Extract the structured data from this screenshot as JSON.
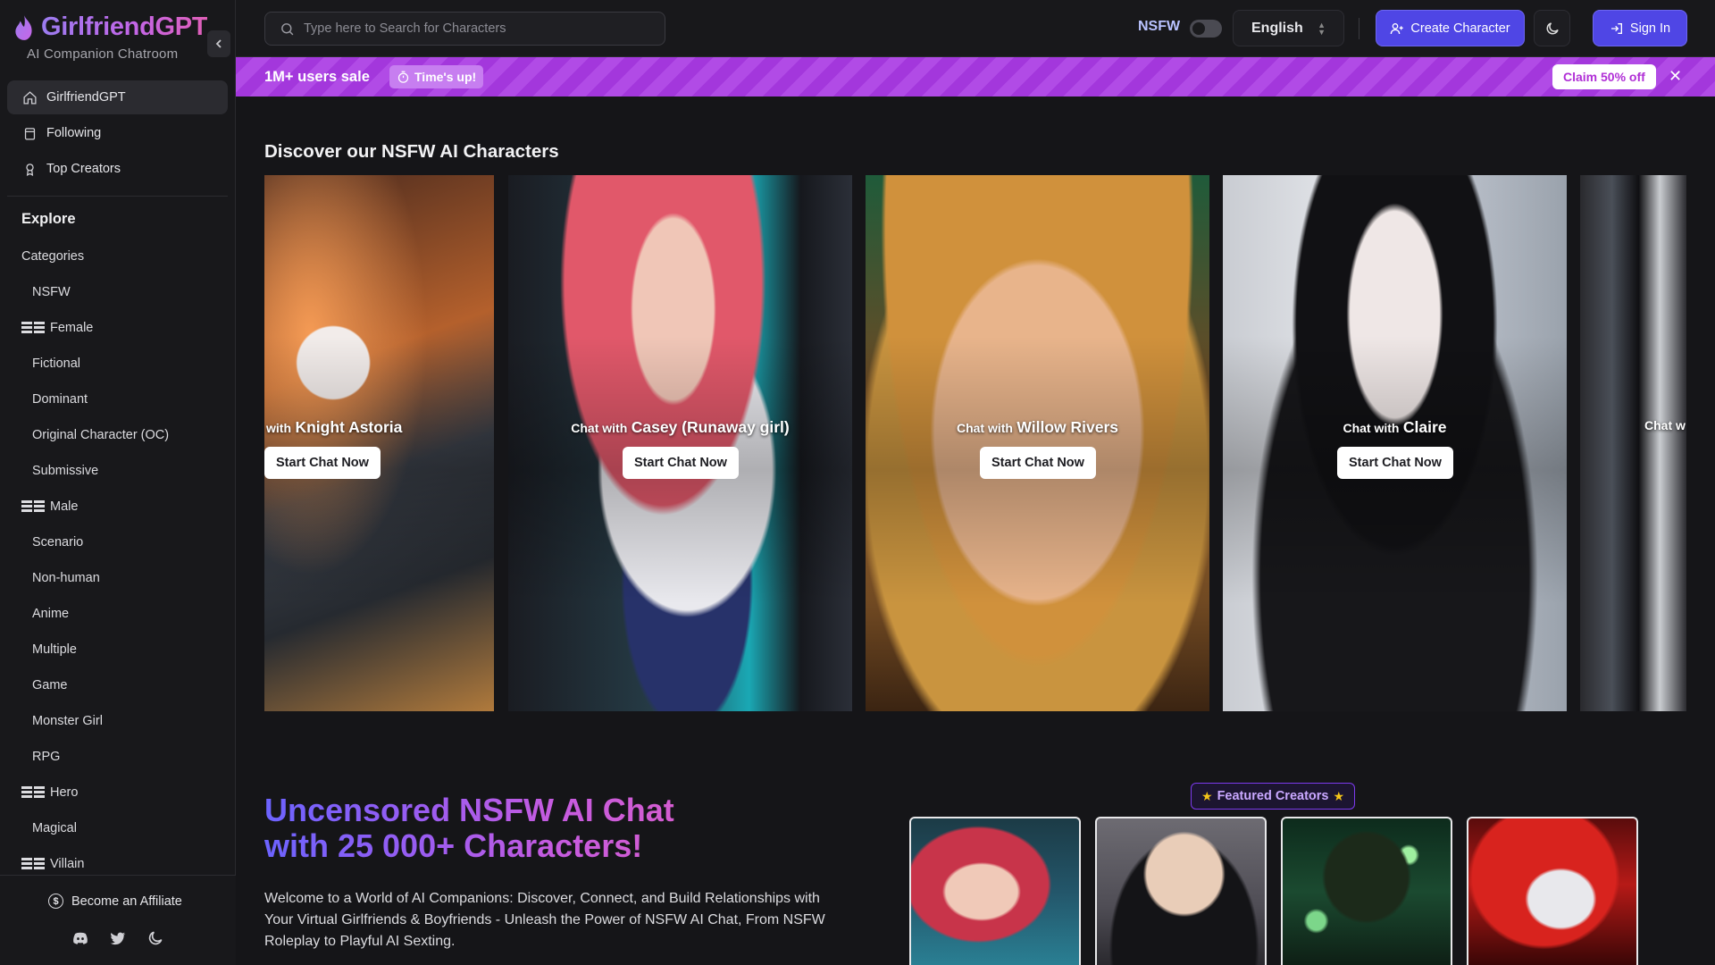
{
  "app": {
    "title": "GirlfriendGPT",
    "subtitle": "AI Companion Chatroom"
  },
  "colors": {
    "accent": "#4f46e5",
    "promo": "#a337dc",
    "brand_gradient_start": "#9b7cf0",
    "brand_gradient_end": "#e05fb8"
  },
  "sidebar": {
    "nav": [
      {
        "label": "GirlfriendGPT",
        "icon": "home-icon",
        "active": true
      },
      {
        "label": "Following",
        "icon": "bookmark-icon"
      },
      {
        "label": "Top Creators",
        "icon": "award-icon"
      }
    ],
    "explore_title": "Explore",
    "categories_label": "Categories",
    "categories": [
      {
        "label": "NSFW",
        "type": "sub"
      },
      {
        "label": "Female",
        "type": "head"
      },
      {
        "label": "Fictional",
        "type": "sub"
      },
      {
        "label": "Dominant",
        "type": "sub"
      },
      {
        "label": "Original Character (OC)",
        "type": "sub"
      },
      {
        "label": "Submissive",
        "type": "sub"
      },
      {
        "label": "Male",
        "type": "head"
      },
      {
        "label": "Scenario",
        "type": "sub"
      },
      {
        "label": "Non-human",
        "type": "sub"
      },
      {
        "label": "Anime",
        "type": "sub"
      },
      {
        "label": "Multiple",
        "type": "sub"
      },
      {
        "label": "Game",
        "type": "sub"
      },
      {
        "label": "Monster Girl",
        "type": "sub"
      },
      {
        "label": "RPG",
        "type": "sub"
      },
      {
        "label": "Hero",
        "type": "head"
      },
      {
        "label": "Magical",
        "type": "sub"
      },
      {
        "label": "Villain",
        "type": "head"
      }
    ],
    "affiliate_label": "Become an Affiliate",
    "socials": [
      "discord-icon",
      "twitter-icon",
      "moon-icon"
    ]
  },
  "header": {
    "search_placeholder": "Type here to Search for Characters",
    "nsfw_label": "NSFW",
    "nsfw_enabled": false,
    "language": "English",
    "create_label": "Create Character",
    "signin_label": "Sign In"
  },
  "promo": {
    "title": "1M+ users sale",
    "timer_label": "Time's up!",
    "claim_label": "Claim 50% off",
    "close_glyph": "✕"
  },
  "discover": {
    "title": "Discover our NSFW AI Characters",
    "cards": [
      {
        "prefix": "with",
        "name": "Knight Astoria",
        "button": "Start Chat Now"
      },
      {
        "prefix": "Chat with",
        "name": "Casey (Runaway girl)",
        "button": "Start Chat Now"
      },
      {
        "prefix": "Chat with",
        "name": "Willow Rivers",
        "button": "Start Chat Now"
      },
      {
        "prefix": "Chat with",
        "name": "Claire",
        "button": "Start Chat Now"
      },
      {
        "prefix": "Chat w",
        "name": "",
        "button": ""
      }
    ]
  },
  "hero": {
    "title_line1": "Uncensored NSFW AI Chat",
    "title_line2": "with 25 000+ Characters!",
    "description": "Welcome to a World of AI Companions: Discover, Connect, and Build Relationships with Your Virtual Girlfriends & Boyfriends - Unleash the Power of NSFW AI Chat, From NSFW Roleplay to Playful AI Sexting."
  },
  "featured": {
    "label": "Featured Creators",
    "star": "★"
  }
}
